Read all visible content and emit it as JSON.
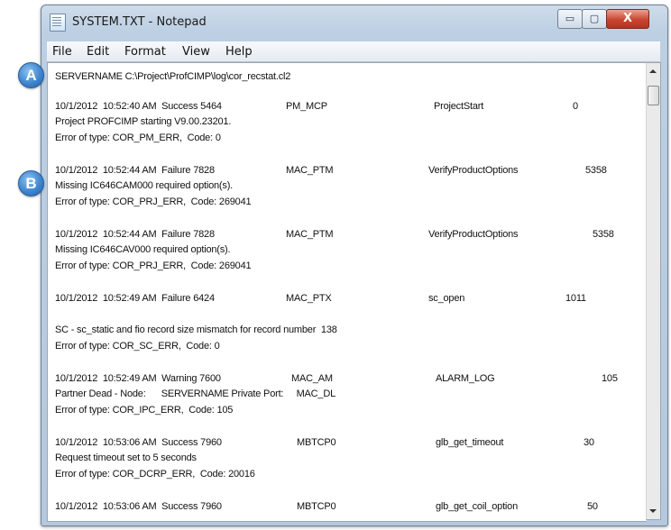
{
  "window": {
    "title": "SYSTEM.TXT - Notepad"
  },
  "controls": {
    "minimize": "▭",
    "maximize": "▢",
    "close": "X"
  },
  "menu": [
    "File",
    "Edit",
    "Format",
    "View",
    "Help"
  ],
  "markers": {
    "a": "A",
    "b": "B"
  },
  "lines": [
    "SERVERNAME C:\\Project\\ProfCIMP\\log\\cor_recstat.cl2",
    "10/1/2012  10:52:40 AM  Success 5464",
    "PM_MCP",
    "ProjectStart",
    "0",
    "Project PROFCIMP starting V9.00.23201.",
    "Error of type: COR_PM_ERR,  Code: 0",
    "10/1/2012  10:52:44 AM  Failure 7828",
    "MAC_PTM",
    "VerifyProductOptions",
    "5358",
    "Missing IC646CAM000 required option(s).",
    "Error of type: COR_PRJ_ERR,  Code: 269041",
    "10/1/2012  10:52:44 AM  Failure 7828",
    "MAC_PTM",
    "VerifyProductOptions",
    "5358",
    "Missing IC646CAV000 required option(s).",
    "Error of type: COR_PRJ_ERR,  Code: 269041",
    "10/1/2012  10:52:49 AM  Failure 6424",
    "MAC_PTX",
    "sc_open",
    "1011",
    "SC - sc_static and fio record size mismatch for record number  138",
    "Error of type: COR_SC_ERR,  Code: 0",
    "10/1/2012  10:52:49 AM  Warning 7600",
    "MAC_AM",
    "ALARM_LOG",
    "105",
    "Partner Dead - Node:      SERVERNAME Private Port:     MAC_DL",
    "Error of type: COR_IPC_ERR,  Code: 105",
    "10/1/2012  10:53:06 AM  Success 7960",
    "MBTCP0",
    "glb_get_timeout",
    "30",
    "Request timeout set to 5 seconds",
    "Error of type: COR_DCRP_ERR,  Code: 20016",
    "10/1/2012  10:53:06 AM  Success 7960",
    "MBTCP0",
    "glb_get_coil_option",
    "50"
  ]
}
